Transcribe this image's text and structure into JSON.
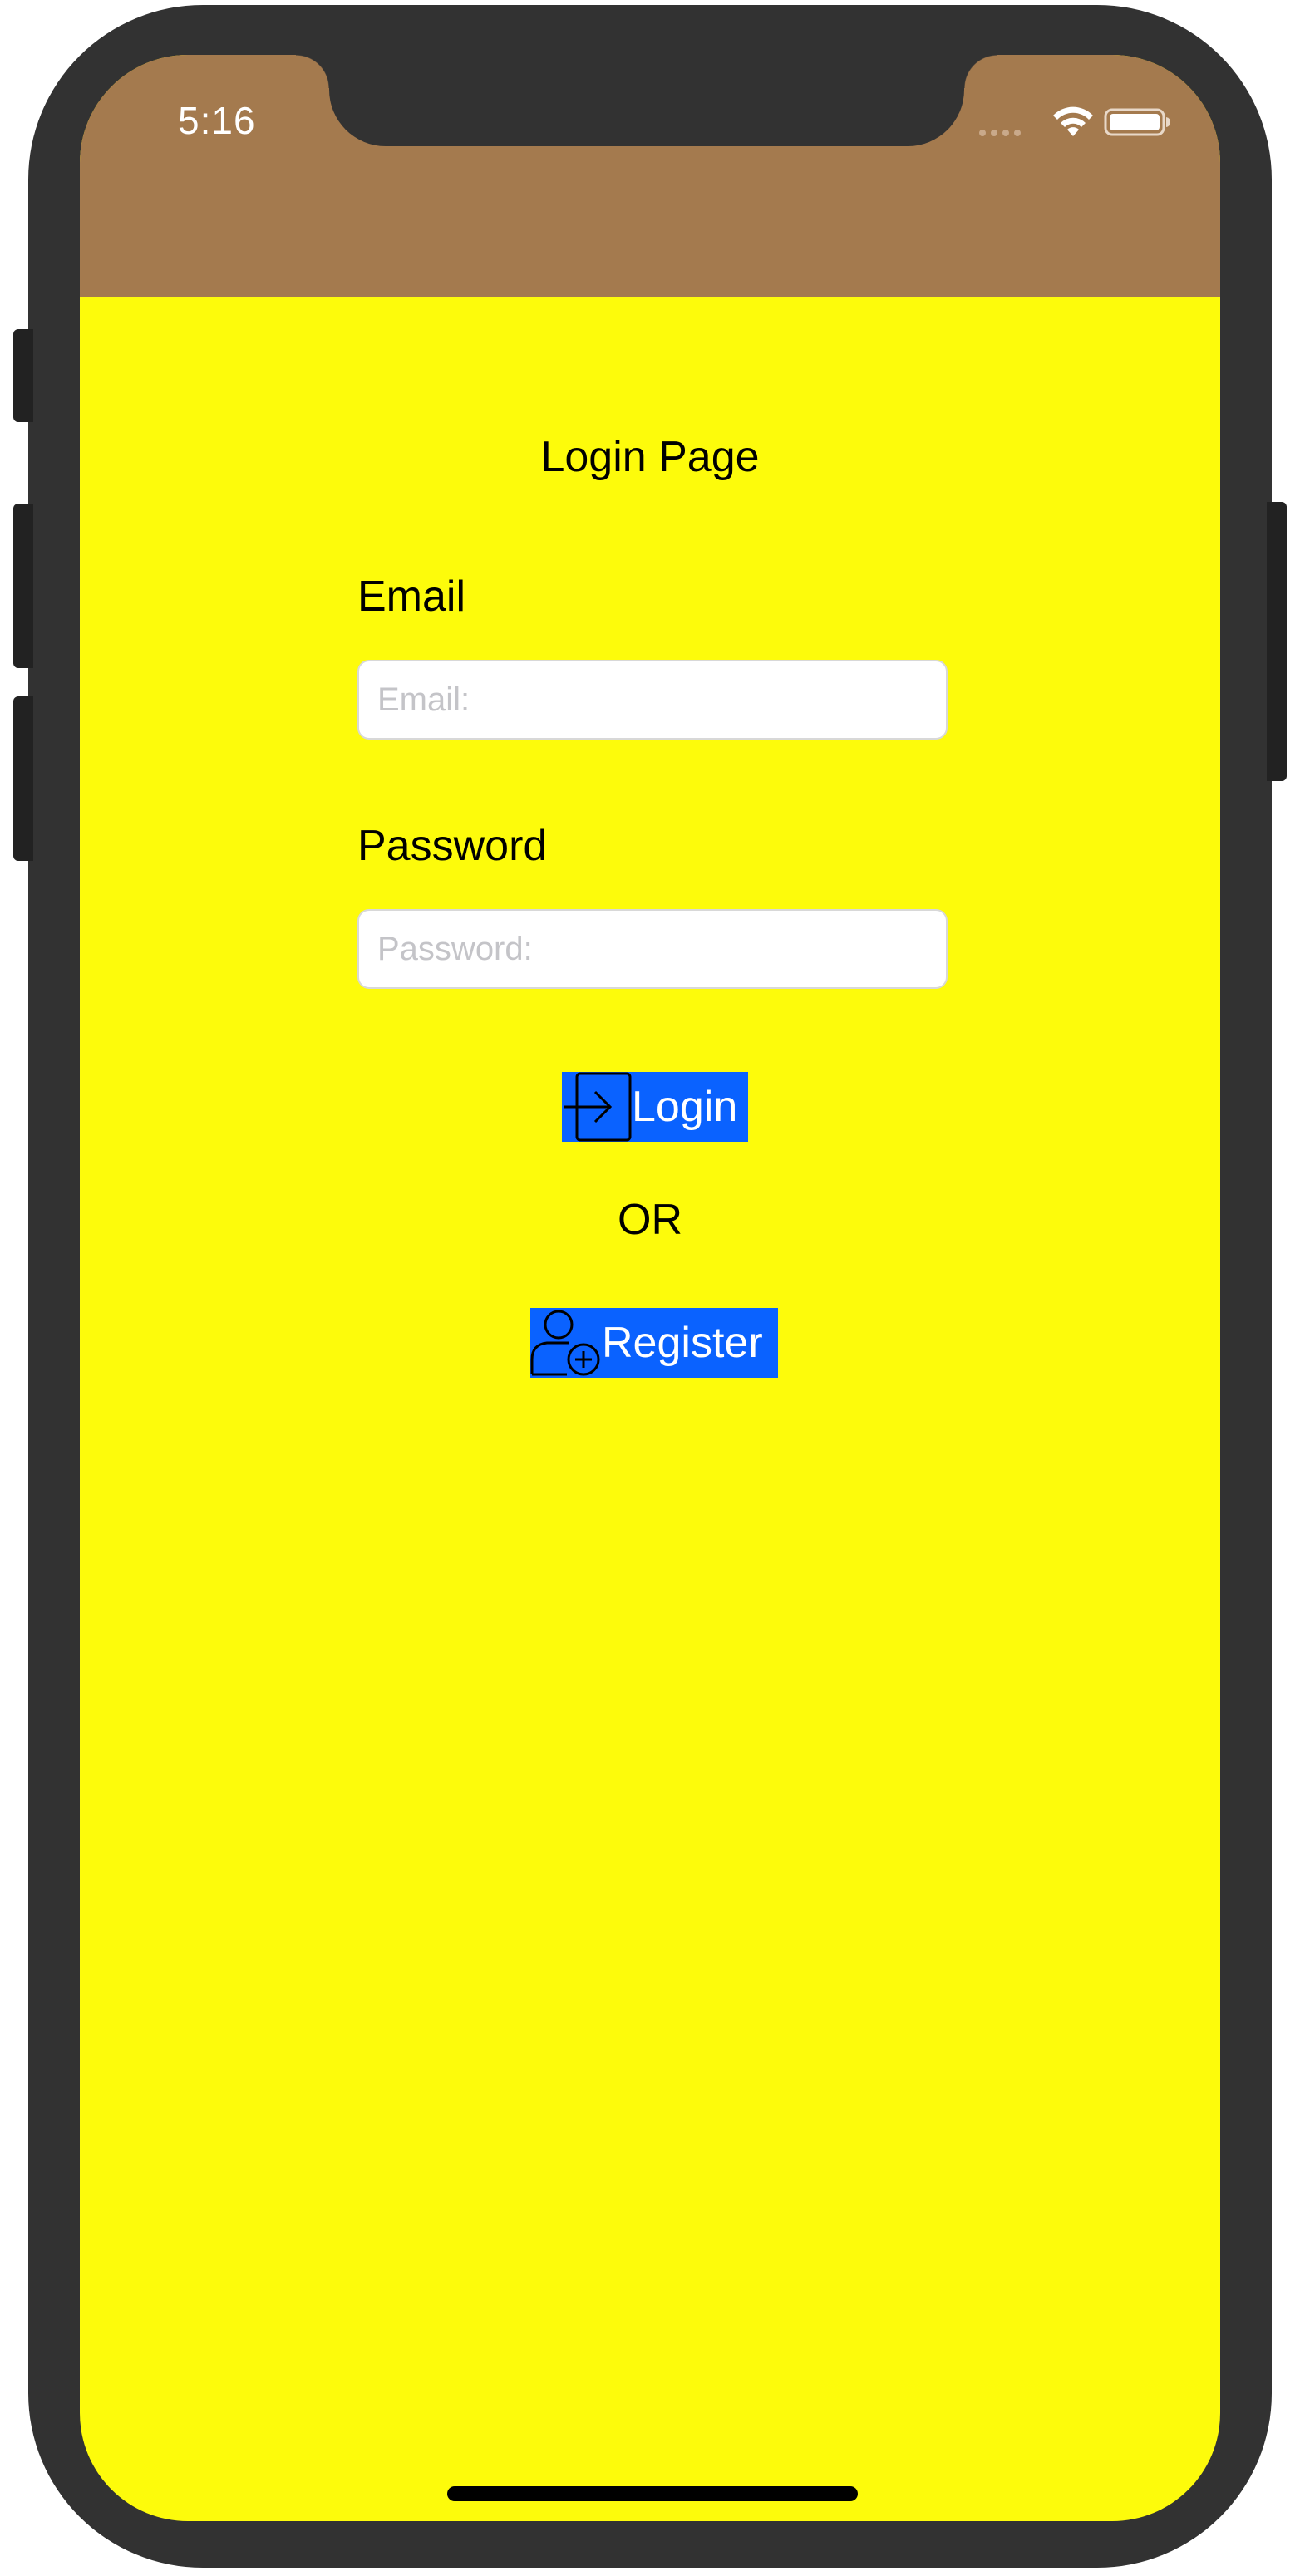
{
  "status_bar": {
    "time": "5:16",
    "icons": [
      "signal-dots-icon",
      "wifi-icon",
      "battery-icon"
    ],
    "background_color": "#a47a4e"
  },
  "page": {
    "background_color": "#fdfb0b",
    "title": "Login Page"
  },
  "form": {
    "email_label": "Email",
    "email_placeholder": "Email:",
    "email_value": "",
    "password_label": "Password",
    "password_placeholder": "Password:",
    "password_value": ""
  },
  "buttons": {
    "login_label": "Login",
    "login_icon": "sign-in-icon",
    "or_text": "OR",
    "register_label": "Register",
    "register_icon": "add-user-icon",
    "button_color": "#0a62ff"
  }
}
